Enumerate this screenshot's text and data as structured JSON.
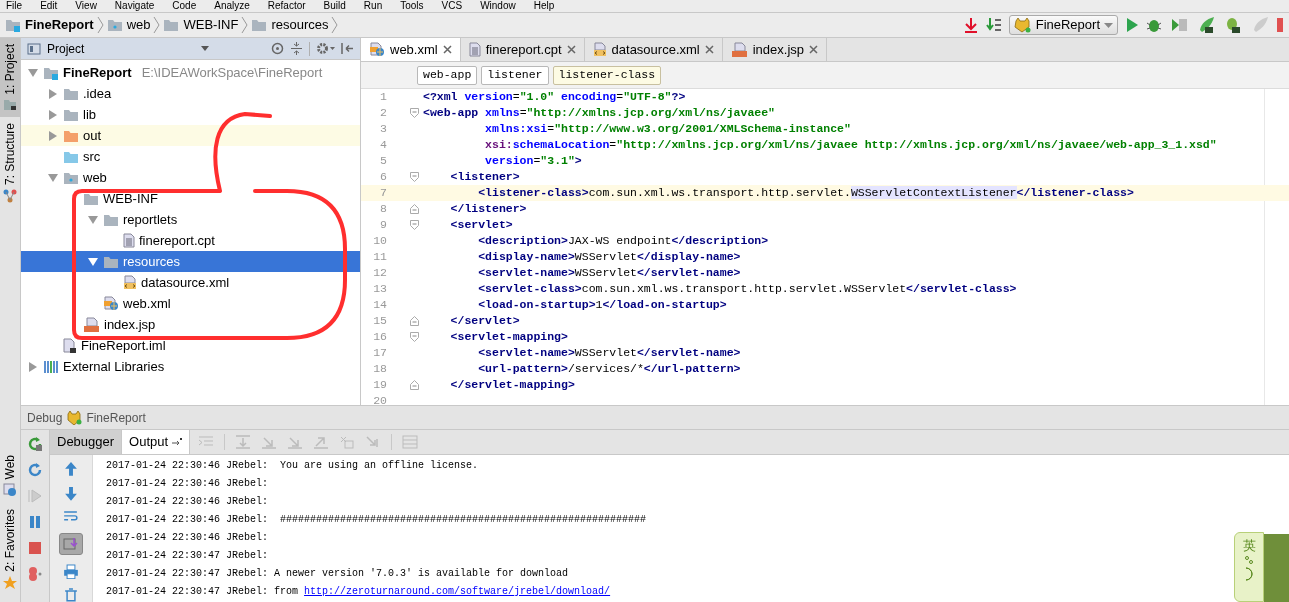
{
  "menu_bar": [
    "File",
    "Edit",
    "View",
    "Navigate",
    "Code",
    "Analyze",
    "Refactor",
    "Build",
    "Run",
    "Tools",
    "VCS",
    "Window",
    "Help"
  ],
  "nav_bar": {
    "breadcrumbs": [
      {
        "label": "FineReport",
        "kind": "module"
      },
      {
        "label": "web",
        "kind": "web"
      },
      {
        "label": "WEB-INF",
        "kind": "folder"
      },
      {
        "label": "resources",
        "kind": "folder"
      }
    ],
    "run_config": "FineReport"
  },
  "left_tool_tabs": [
    {
      "label": "1: Project",
      "kind": "project",
      "selected": true
    },
    {
      "label": "7: Structure",
      "kind": "structure",
      "selected": false
    }
  ],
  "bottom_tool_tabs": [
    {
      "label": "Web",
      "kind": "web",
      "selected": false
    },
    {
      "label": "2: Favorites",
      "kind": "favorites",
      "selected": false
    }
  ],
  "project_panel": {
    "title": "Project",
    "tree": [
      {
        "label": "FineReport",
        "kind": "module",
        "path": "E:\\IDEAWorkSpace\\FineReport",
        "expanded": true,
        "selected": false,
        "highlighted": false,
        "children": [
          {
            "label": ".idea",
            "kind": "folder",
            "expanded": false,
            "selected": false,
            "highlighted": false
          },
          {
            "label": "lib",
            "kind": "folder",
            "expanded": false,
            "selected": false,
            "highlighted": false
          },
          {
            "label": "out",
            "kind": "excluded",
            "expanded": false,
            "selected": false,
            "highlighted": true
          },
          {
            "label": "src",
            "kind": "source",
            "selected": false,
            "highlighted": false
          },
          {
            "label": "web",
            "kind": "web",
            "expanded": true,
            "selected": false,
            "highlighted": false,
            "children": [
              {
                "label": "WEB-INF",
                "kind": "folder",
                "selected": false,
                "highlighted": false,
                "children": [
                  {
                    "label": "reportlets",
                    "kind": "folder",
                    "expanded": true,
                    "selected": false,
                    "highlighted": false,
                    "children": [
                      {
                        "label": "finereport.cpt",
                        "kind": "text",
                        "selected": false,
                        "highlighted": false
                      }
                    ]
                  },
                  {
                    "label": "resources",
                    "kind": "folder",
                    "expanded": true,
                    "selected": true,
                    "highlighted": false,
                    "children": [
                      {
                        "label": "datasource.xml",
                        "kind": "xml",
                        "selected": false,
                        "highlighted": false
                      }
                    ]
                  },
                  {
                    "label": "web.xml",
                    "kind": "webxml",
                    "selected": false,
                    "highlighted": false
                  }
                ]
              },
              {
                "label": "index.jsp",
                "kind": "jsp",
                "selected": false,
                "highlighted": false
              }
            ]
          },
          {
            "label": "FineReport.iml",
            "kind": "iml",
            "selected": false,
            "highlighted": false
          }
        ]
      },
      {
        "label": "External Libraries",
        "kind": "libraries",
        "expanded": false,
        "selected": false,
        "highlighted": false
      }
    ]
  },
  "editor": {
    "tabs": [
      {
        "label": "web.xml",
        "kind": "webxml",
        "selected": true
      },
      {
        "label": "finereport.cpt",
        "kind": "text",
        "selected": false
      },
      {
        "label": "datasource.xml",
        "kind": "xml",
        "selected": false
      },
      {
        "label": "index.jsp",
        "kind": "jsp",
        "selected": false
      }
    ],
    "breadcrumbs": [
      {
        "label": "web-app",
        "selected": false
      },
      {
        "label": "listener",
        "selected": false
      },
      {
        "label": "listener-class",
        "selected": true
      }
    ],
    "lines": [
      {
        "number": "1",
        "selected": false,
        "tokens": [
          {
            "kind": "tag",
            "text": "<?xml"
          },
          {
            "kind": "attr",
            "text": " version"
          },
          {
            "kind": "text",
            "text": "="
          },
          {
            "kind": "value",
            "text": "\"1.0\""
          },
          {
            "kind": "attr",
            "text": " encoding"
          },
          {
            "kind": "text",
            "text": "="
          },
          {
            "kind": "value",
            "text": "\"UTF-8\""
          },
          {
            "kind": "tag",
            "text": "?>"
          }
        ]
      },
      {
        "number": "2",
        "selected": false,
        "fold_start": true,
        "tokens": [
          {
            "kind": "tag",
            "text": "<web-app"
          },
          {
            "kind": "attr",
            "text": " xmlns"
          },
          {
            "kind": "text",
            "text": "="
          },
          {
            "kind": "value",
            "text": "\"http://xmlns.jcp.org/xml/ns/javaee\""
          }
        ]
      },
      {
        "number": "3",
        "selected": false,
        "tokens": [
          {
            "kind": "attr",
            "text": "         xmlns:xsi"
          },
          {
            "kind": "text",
            "text": "="
          },
          {
            "kind": "value",
            "text": "\"http://www.w3.org/2001/XMLSchema-instance\""
          }
        ]
      },
      {
        "number": "4",
        "selected": false,
        "tokens": [
          {
            "kind": "ns",
            "text": "         xsi:"
          },
          {
            "kind": "attr",
            "text": "schemaLocation"
          },
          {
            "kind": "text",
            "text": "="
          },
          {
            "kind": "value",
            "text": "\"http://xmlns.jcp.org/xml/ns/javaee http://xmlns.jcp.org/xml/ns/javaee/web-app_3_1.xsd\""
          }
        ]
      },
      {
        "number": "5",
        "selected": false,
        "tokens": [
          {
            "kind": "attr",
            "text": "         version"
          },
          {
            "kind": "text",
            "text": "="
          },
          {
            "kind": "value",
            "text": "\"3.1\""
          },
          {
            "kind": "tag",
            "text": ">"
          }
        ]
      },
      {
        "number": "6",
        "selected": false,
        "fold_start": true,
        "tokens": [
          {
            "kind": "tag",
            "text": "    <listener>"
          }
        ]
      },
      {
        "number": "7",
        "selected": true,
        "tokens": [
          {
            "kind": "tag",
            "text": "        <listener-class>"
          },
          {
            "kind": "text",
            "text": "com.sun.xml.ws.transport.http.servlet."
          },
          {
            "kind": "match",
            "text": "WSServletContextListener"
          },
          {
            "kind": "tag",
            "text": "</listener-class>"
          }
        ]
      },
      {
        "number": "8",
        "selected": false,
        "fold_end": true,
        "tokens": [
          {
            "kind": "tag",
            "text": "    </listener>"
          }
        ]
      },
      {
        "number": "9",
        "selected": false,
        "fold_start": true,
        "tokens": [
          {
            "kind": "tag",
            "text": "    <servlet>"
          }
        ]
      },
      {
        "number": "10",
        "selected": false,
        "tokens": [
          {
            "kind": "tag",
            "text": "        <description>"
          },
          {
            "kind": "text",
            "text": "JAX-WS endpoint"
          },
          {
            "kind": "tag",
            "text": "</description>"
          }
        ]
      },
      {
        "number": "11",
        "selected": false,
        "tokens": [
          {
            "kind": "tag",
            "text": "        <display-name>"
          },
          {
            "kind": "text",
            "text": "WSServlet"
          },
          {
            "kind": "tag",
            "text": "</display-name>"
          }
        ]
      },
      {
        "number": "12",
        "selected": false,
        "tokens": [
          {
            "kind": "tag",
            "text": "        <servlet-name>"
          },
          {
            "kind": "text",
            "text": "WSServlet"
          },
          {
            "kind": "tag",
            "text": "</servlet-name>"
          }
        ]
      },
      {
        "number": "13",
        "selected": false,
        "tokens": [
          {
            "kind": "tag",
            "text": "        <servlet-class>"
          },
          {
            "kind": "text",
            "text": "com.sun.xml.ws.transport.http.servlet.WSServlet"
          },
          {
            "kind": "tag",
            "text": "</servlet-class>"
          }
        ]
      },
      {
        "number": "14",
        "selected": false,
        "tokens": [
          {
            "kind": "tag",
            "text": "        <load-on-startup>"
          },
          {
            "kind": "text",
            "text": "1"
          },
          {
            "kind": "tag",
            "text": "</load-on-startup>"
          }
        ]
      },
      {
        "number": "15",
        "selected": false,
        "fold_end": true,
        "tokens": [
          {
            "kind": "tag",
            "text": "    </servlet>"
          }
        ]
      },
      {
        "number": "16",
        "selected": false,
        "fold_start": true,
        "tokens": [
          {
            "kind": "tag",
            "text": "    <servlet-mapping>"
          }
        ]
      },
      {
        "number": "17",
        "selected": false,
        "tokens": [
          {
            "kind": "tag",
            "text": "        <servlet-name>"
          },
          {
            "kind": "text",
            "text": "WSServlet"
          },
          {
            "kind": "tag",
            "text": "</servlet-name>"
          }
        ]
      },
      {
        "number": "18",
        "selected": false,
        "tokens": [
          {
            "kind": "tag",
            "text": "        <url-pattern>"
          },
          {
            "kind": "text",
            "text": "/services/*"
          },
          {
            "kind": "tag",
            "text": "</url-pattern>"
          }
        ]
      },
      {
        "number": "19",
        "selected": false,
        "fold_end": true,
        "tokens": [
          {
            "kind": "tag",
            "text": "    </servlet-mapping>"
          }
        ]
      },
      {
        "number": "20",
        "selected": false
      }
    ]
  },
  "debug": {
    "title": "Debug",
    "config": "FineReport",
    "tabs": [
      {
        "label": "Debugger",
        "selected": false
      },
      {
        "label": "Output",
        "selected": true
      }
    ],
    "output": [
      {
        "text": "2017-01-24 22:30:46 JRebel:  You are using an offline license."
      },
      {
        "text": "2017-01-24 22:30:46 JRebel:"
      },
      {
        "text": "2017-01-24 22:30:46 JRebel:"
      },
      {
        "text": "2017-01-24 22:30:46 JRebel:  #############################################################"
      },
      {
        "text": "2017-01-24 22:30:46 JRebel:"
      },
      {
        "text": "2017-01-24 22:30:47 JRebel:"
      },
      {
        "text": "2017-01-24 22:30:47 JRebel: A newer version '7.0.3' is available for download"
      },
      {
        "text": "2017-01-24 22:30:47 JRebel: from ",
        "link": "http://zeroturnaround.com/software/jrebel/download/"
      }
    ]
  },
  "ime_toolbar": {
    "label": "英"
  }
}
